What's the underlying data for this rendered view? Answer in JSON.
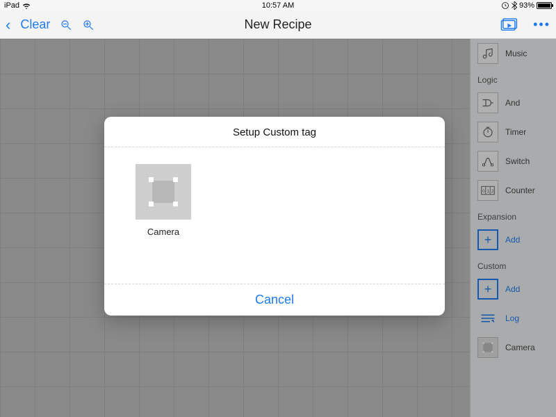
{
  "status": {
    "device": "iPad",
    "time": "10:57 AM",
    "battery_pct": "93%"
  },
  "toolbar": {
    "clear": "Clear",
    "title": "New Recipe"
  },
  "sidebar": {
    "top_item": {
      "label": "Music"
    },
    "sections": [
      {
        "title": "Logic",
        "items": [
          {
            "label": "And"
          },
          {
            "label": "Timer"
          },
          {
            "label": "Switch"
          },
          {
            "label": "Counter"
          }
        ]
      },
      {
        "title": "Expansion",
        "items": [
          {
            "label": "Add",
            "blue": true,
            "plus": true
          }
        ]
      },
      {
        "title": "Custom",
        "items": [
          {
            "label": "Add",
            "blue": true,
            "plus": true
          },
          {
            "label": "Log",
            "blue": true
          },
          {
            "label": "Camera"
          }
        ]
      }
    ]
  },
  "modal": {
    "title": "Setup Custom tag",
    "tile_label": "Camera",
    "cancel": "Cancel"
  }
}
